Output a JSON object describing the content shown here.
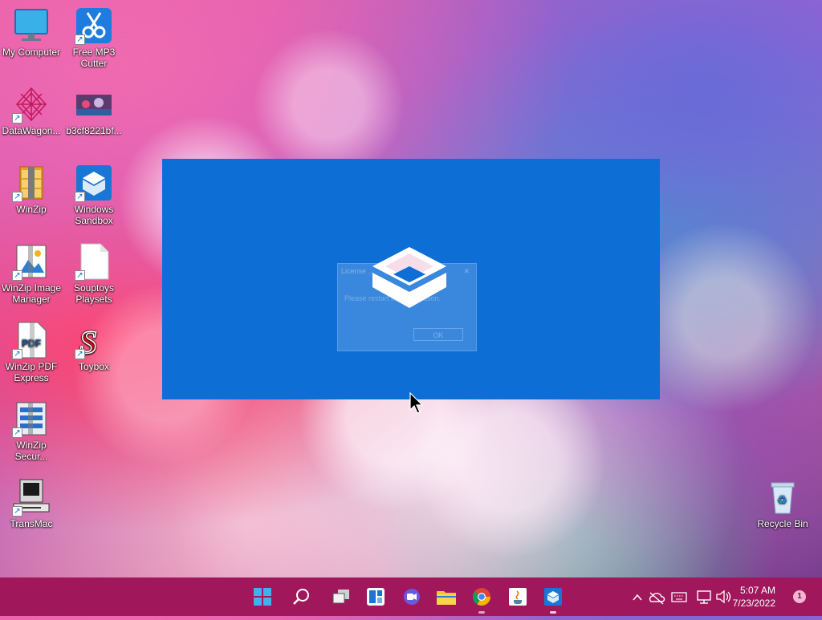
{
  "desktop": {
    "icons": [
      {
        "label": "My Computer",
        "icon": "monitor-icon"
      },
      {
        "label": "Free MP3 Cutter",
        "icon": "scissors-icon"
      },
      {
        "label": "DataWagon...",
        "icon": "datawagon-icon"
      },
      {
        "label": "b3cf8221bf...",
        "icon": "image-file-icon"
      },
      {
        "label": "WinZip",
        "icon": "winzip-icon"
      },
      {
        "label": "Windows Sandbox",
        "icon": "windows-sandbox-icon"
      },
      {
        "label": "WinZip Image Manager",
        "icon": "winzip-image-manager-icon"
      },
      {
        "label": "Souptoys Playsets",
        "icon": "blank-file-icon"
      },
      {
        "label": "WinZip PDF Express",
        "icon": "pdf-icon"
      },
      {
        "label": "Toybox",
        "icon": "toybox-icon"
      },
      {
        "label": "WinZip Secur...",
        "icon": "winzip-secure-icon"
      },
      {
        "label": "TransMac",
        "icon": "transmac-icon"
      },
      {
        "label": "Recycle Bin",
        "icon": "recycle-bin-icon"
      }
    ]
  },
  "sandbox": {
    "dialog": {
      "title": "License ...",
      "message": "Please restart this application.",
      "ok_label": "OK"
    }
  },
  "taskbar": {
    "apps": [
      "windows-start-icon",
      "search-icon",
      "task-view-icon",
      "widgets-icon",
      "teams-chat-icon",
      "file-explorer-icon",
      "chrome-icon",
      "java-icon",
      "windows-sandbox-icon"
    ],
    "tray": [
      "chevron-up-icon",
      "onedrive-icon",
      "keyboard-icon",
      "network-icon",
      "volume-icon"
    ]
  },
  "clock": {
    "time": "5:07 AM",
    "date": "7/23/2022"
  },
  "notifications": {
    "count": "1"
  },
  "colors": {
    "taskbar": "#a0175c",
    "sandbox_blue": "#0d6ed6"
  }
}
